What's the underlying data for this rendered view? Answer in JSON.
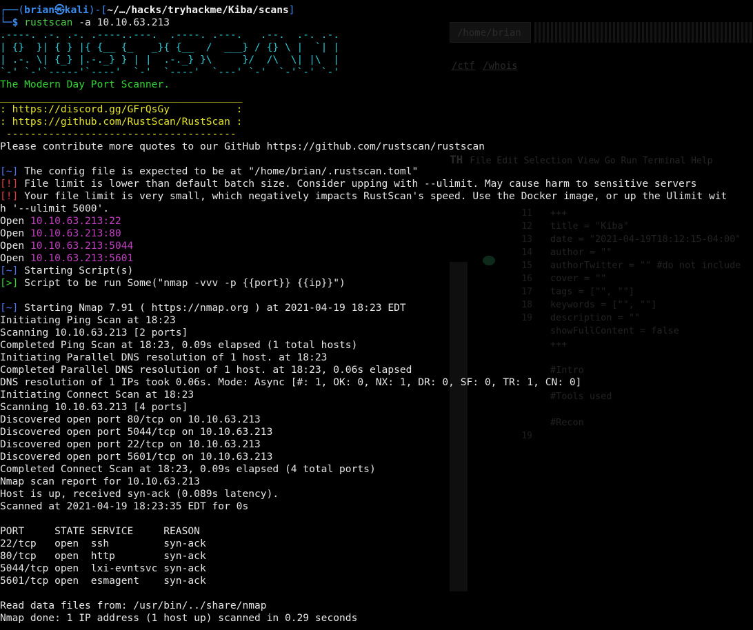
{
  "prompt": {
    "frame_top": "┌──(",
    "user": "brian㉿kali",
    "frame_mid": ")-[",
    "path": "~/…/hacks/tryhackme/Kiba/scans",
    "frame_end": "]",
    "frame_bottom": "└─",
    "dollar": "$",
    "cmd": "rustscan",
    "args": " -a 10.10.63.213"
  },
  "banner": [
    ".----. .-. .-. .----..---.  .----. .---.   .--.  .-. .-.",
    "| {}  }| { } |{ {__ {_   _}{ {__  /  ___} / {} \\ |  `| |",
    "| .-. \\| {_} |.-._} } | |  .-._} }\\     }/  /\\  \\| |\\  |",
    "`-' `-'`-----'`----'  `-'  `----'  `---' `-'  `-'`-' `-'"
  ],
  "tagline": "The Modern Day Port Scanner.",
  "yellow_box": [
    "________________________________________",
    ": https://discord.gg/GFrQsGy           :",
    ": https://github.com/RustScan/RustScan :",
    " --------------------------------------"
  ],
  "quote": "Please contribute more quotes to our GitHub https://github.com/rustscan/rustscan",
  "messages": [
    {
      "tag": "[~]",
      "tag_color": "blue",
      "text": " The config file is expected to be at \"/home/brian/.rustscan.toml\""
    },
    {
      "tag": "[!]",
      "tag_color": "red",
      "text": " File limit is lower than default batch size. Consider upping with --ulimit. May cause harm to sensitive servers"
    },
    {
      "tag": "[!]",
      "tag_color": "red",
      "text": " Your file limit is very small, which negatively impacts RustScan's speed. Use the Docker image, or up the Ulimit wit"
    },
    {
      "tag": "",
      "tag_color": "",
      "text": "h '--ulimit 5000'."
    }
  ],
  "open_ports": [
    {
      "label": "Open ",
      "addr": "10.10.63.213:22"
    },
    {
      "label": "Open ",
      "addr": "10.10.63.213:80"
    },
    {
      "label": "Open ",
      "addr": "10.10.63.213:5044"
    },
    {
      "label": "Open ",
      "addr": "10.10.63.213:5601"
    }
  ],
  "script_lines": [
    {
      "tag": "[~]",
      "tag_color": "blue",
      "text": " Starting Script(s)"
    },
    {
      "tag": "[>]",
      "tag_color": "green",
      "text": " Script to be run Some(\"nmap -vvv -p {{port}} {{ip}}\")"
    },
    {
      "tag": "",
      "tag_color": "",
      "text": ""
    },
    {
      "tag": "[~]",
      "tag_color": "blue",
      "text": " Starting Nmap 7.91 ( https://nmap.org ) at 2021-04-19 18:23 EDT"
    }
  ],
  "nmap_lines": [
    "Initiating Ping Scan at 18:23",
    "Scanning 10.10.63.213 [2 ports]",
    "Completed Ping Scan at 18:23, 0.09s elapsed (1 total hosts)",
    "Initiating Parallel DNS resolution of 1 host. at 18:23",
    "Completed Parallel DNS resolution of 1 host. at 18:23, 0.06s elapsed",
    "DNS resolution of 1 IPs took 0.06s. Mode: Async [#: 1, OK: 0, NX: 1, DR: 0, SF: 0, TR: 1, CN: 0]",
    "Initiating Connect Scan at 18:23",
    "Scanning 10.10.63.213 [4 ports]",
    "Discovered open port 80/tcp on 10.10.63.213",
    "Discovered open port 5044/tcp on 10.10.63.213",
    "Discovered open port 22/tcp on 10.10.63.213",
    "Discovered open port 5601/tcp on 10.10.63.213",
    "Completed Connect Scan at 18:23, 0.09s elapsed (4 total ports)",
    "Nmap scan report for 10.10.63.213",
    "Host is up, received syn-ack (0.089s latency).",
    "Scanned at 2021-04-19 18:23:35 EDT for 0s",
    "",
    "PORT     STATE SERVICE     REASON",
    "22/tcp   open  ssh         syn-ack",
    "80/tcp   open  http        syn-ack",
    "5044/tcp open  lxi-evntsvc syn-ack",
    "5601/tcp open  esmagent    syn-ack",
    "",
    "Read data files from: /usr/bin/../share/nmap",
    "Nmap done: 1 IP address (1 host up) scanned in 0.29 seconds"
  ],
  "background": {
    "crumb": "/home/brian",
    "links": [
      "/ctf",
      "/whois"
    ],
    "menu_title": "TH",
    "menu_items": "File  Edit  Selection  View  Go  Run  Terminal  Help",
    "gutter": "11\n12\n13\n14\n15\n16\n17\n18\n19\n\n\n\n\n\n\n\n\n19",
    "code": "+++\ntitle = \"Kiba\"\ndate = \"2021-04-19T18:12:15-04:00\"\nauthor = \"\"\nauthorTwitter = \"\" #do not include\ncover = \"\"\ntags = [\"\", \"\"]\nkeywords = [\"\", \"\"]\ndescription = \"\"\nshowFullContent = false\n+++\n\n#Intro\n\n#Tools used\n\n#Recon\n"
  },
  "colors": {
    "background": "#000000",
    "prompt_blue": "#3b8ef0",
    "banner_cyan": "#2ec8d0",
    "tag_red": "#e23c3c",
    "tag_green": "#33d433",
    "addr_magenta": "#c23fc2",
    "box_yellow": "#e4e42a"
  }
}
